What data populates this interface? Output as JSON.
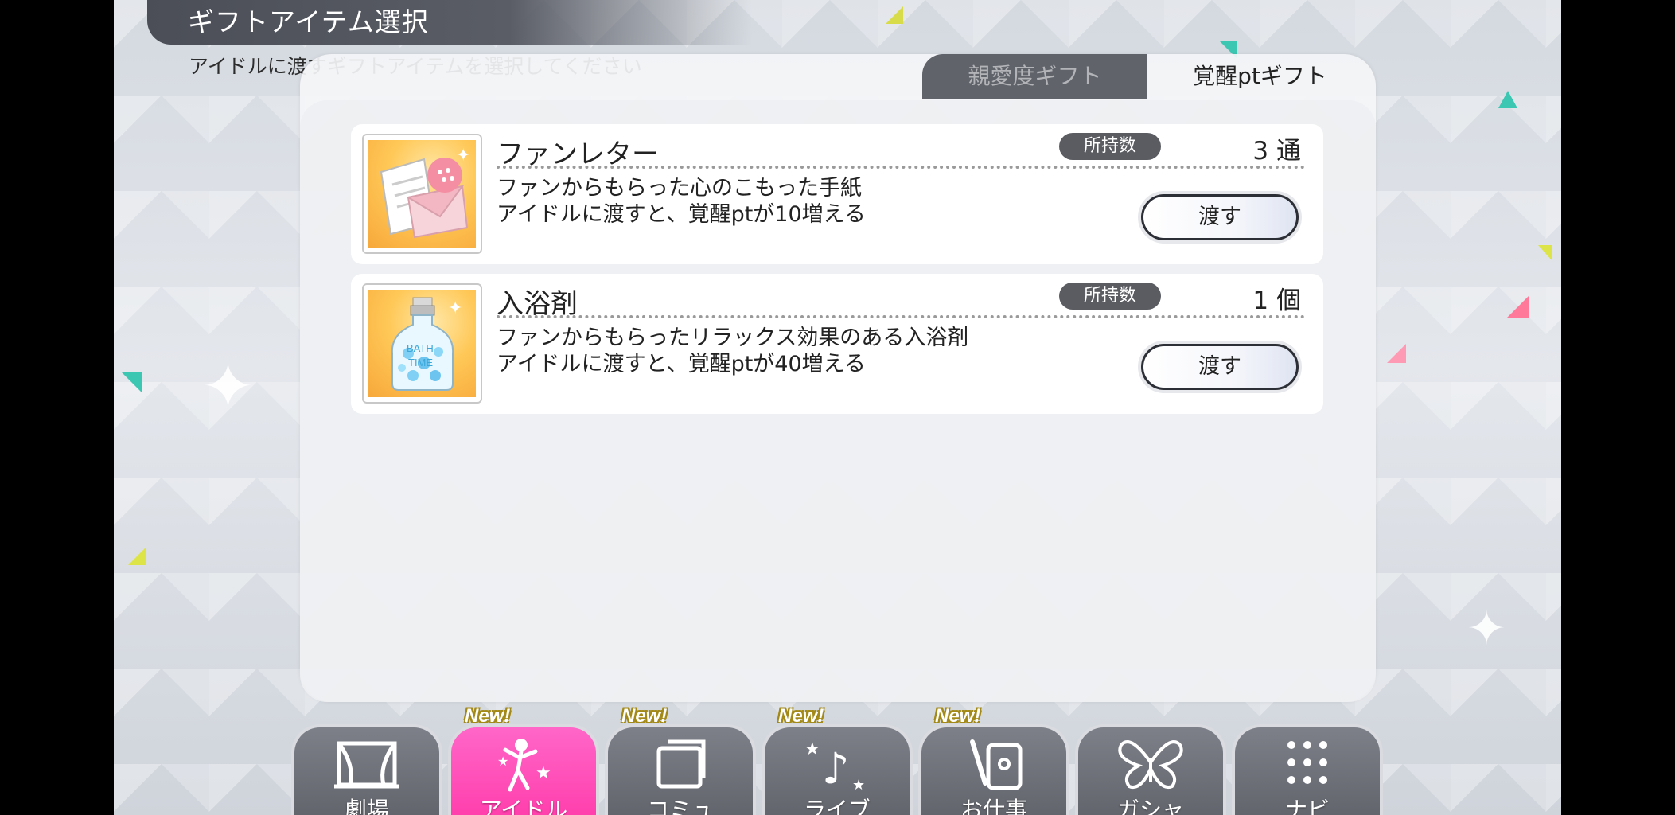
{
  "header": {
    "title": "ギフトアイテム選択",
    "subtitle": "アイドルに渡すギフトアイテムを選択してください"
  },
  "tabs": [
    {
      "label": "親愛度ギフト",
      "active": false
    },
    {
      "label": "覚醒ptギフト",
      "active": true
    }
  ],
  "items": [
    {
      "name": "ファンレター",
      "own_label": "所持数",
      "count": "3 通",
      "desc_line1": "ファンからもらった心のこもった手紙",
      "desc_line2": "アイドルに渡すと、覚醒ptが10増える",
      "button_label": "渡す",
      "icon": "fan-letter-icon"
    },
    {
      "name": "入浴剤",
      "own_label": "所持数",
      "count": "1 個",
      "desc_line1": "ファンからもらったリラックス効果のある入浴剤",
      "desc_line2": "アイドルに渡すと、覚醒ptが40増える",
      "button_label": "渡す",
      "icon": "bath-salt-icon"
    }
  ],
  "nav": [
    {
      "label": "劇場",
      "icon": "theater-icon",
      "new": false,
      "active": false
    },
    {
      "label": "アイドル",
      "icon": "idol-icon",
      "new": true,
      "active": true
    },
    {
      "label": "コミュ",
      "icon": "commu-icon",
      "new": true,
      "active": false
    },
    {
      "label": "ライブ",
      "icon": "live-icon",
      "new": true,
      "active": false
    },
    {
      "label": "お仕事",
      "icon": "work-icon",
      "new": true,
      "active": false
    },
    {
      "label": "ガシャ",
      "icon": "gacha-icon",
      "new": false,
      "active": false
    },
    {
      "label": "ナビ",
      "icon": "navi-icon",
      "new": false,
      "active": false
    }
  ],
  "new_badge_text": "New!",
  "colors": {
    "active_nav": "#ff3aa9",
    "inactive_nav": "#62646c",
    "badge": "#5a5c62"
  }
}
